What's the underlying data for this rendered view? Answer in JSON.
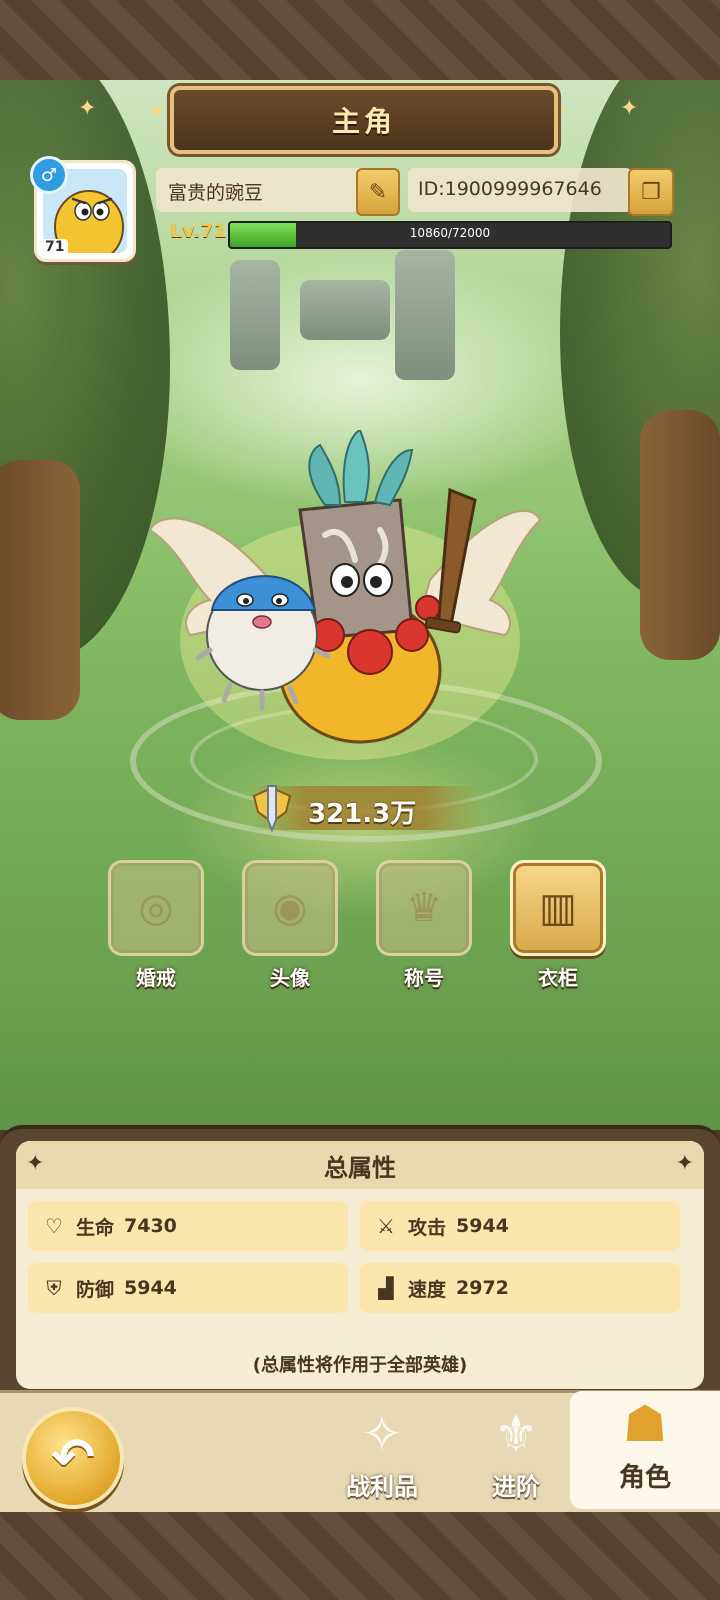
{
  "header": {
    "title": "主角"
  },
  "profile": {
    "avatar_level": "71",
    "gender_symbol": "♂",
    "name": "富贵的豌豆",
    "id": "ID:1900999967646",
    "level_label": "Lv.71",
    "xp_text": "10860/72000",
    "xp_fraction": 0.151
  },
  "power": {
    "value": "321.3万"
  },
  "features": [
    {
      "label": "婚戒",
      "icon": "ring-icon",
      "active": false
    },
    {
      "label": "头像",
      "icon": "avatar-frame-icon",
      "active": false
    },
    {
      "label": "称号",
      "icon": "crown-icon",
      "active": false
    },
    {
      "label": "衣柜",
      "icon": "wardrobe-icon",
      "active": true
    }
  ],
  "stats": {
    "title": "总属性",
    "items": [
      {
        "icon": "heart-icon",
        "label": "生命",
        "value": "7430"
      },
      {
        "icon": "sword-icon",
        "label": "攻击",
        "value": "5944"
      },
      {
        "icon": "shield-icon",
        "label": "防御",
        "value": "5944"
      },
      {
        "icon": "boot-icon",
        "label": "速度",
        "value": "2972"
      }
    ],
    "note": "(总属性将作用于全部英雄)"
  },
  "nav": {
    "back_icon": "back-arrow-icon",
    "items": [
      {
        "label": "战利品",
        "icon": "loot-icon",
        "active": false
      },
      {
        "label": "进阶",
        "icon": "advance-icon",
        "active": false
      },
      {
        "label": "角色",
        "icon": "character-icon",
        "active": true
      }
    ]
  },
  "colors": {
    "xp_fill": "#3ea324",
    "accent_gold": "#e2a72c",
    "panel_bg": "#f4ecd3"
  }
}
